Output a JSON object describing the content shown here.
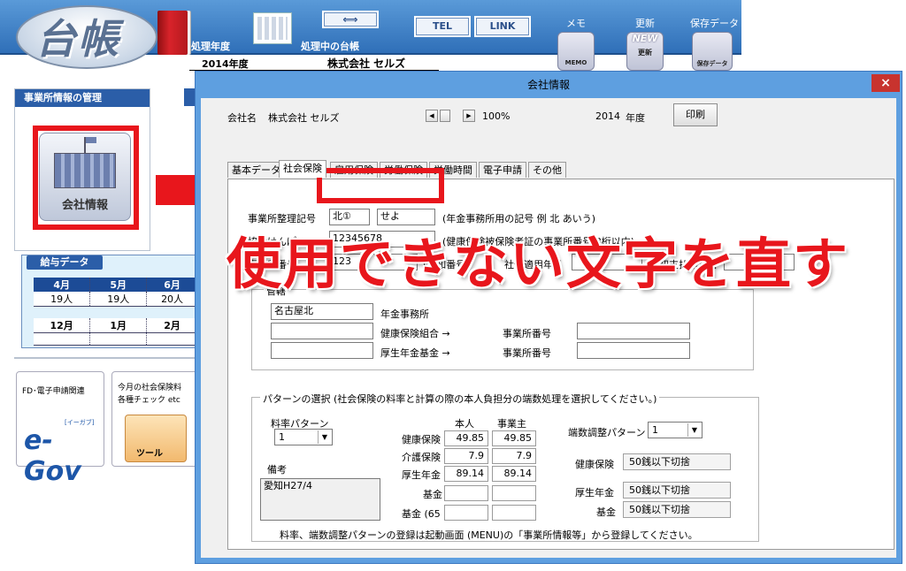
{
  "app": {
    "logo_text": "台帳",
    "top_labels": {
      "year_label": "処理年度",
      "ledger_label": "処理中の台帳",
      "memo": "メモ",
      "update": "更新",
      "save_data": "保存データ"
    },
    "nav": {
      "tel": "TEL",
      "link": "LINK"
    },
    "fiscal_year": "2014年度",
    "company": "株式会社 セルズ",
    "icon_labels": {
      "memo": "MEMO",
      "update_new": "NEW",
      "update_small": "更新",
      "save": "保存データ"
    },
    "left_panel": {
      "header": "事業所情報の管理",
      "company_info_button": "会社情報"
    },
    "salary": {
      "header": "給与データ",
      "row1_months": [
        "4月",
        "5月",
        "6月"
      ],
      "row1_counts": [
        "19人",
        "19人",
        "20人"
      ],
      "row2_months": [
        "12月",
        "1月",
        "2月"
      ]
    },
    "tiles": {
      "fd_label": "FD･電子申請関連",
      "egov": "e-Gov",
      "egov_small": "[イーガブ]",
      "monthly_line1": "今月の社会保険料",
      "monthly_line2": "各種チェック etc",
      "tool": "ツール"
    }
  },
  "dialog": {
    "title": "会社情報",
    "close": "×",
    "company_label": "会社名",
    "company_name": "株式会社 セルズ",
    "zoom": "100%",
    "year": "2014",
    "year_suffix": "年度",
    "print_button": "印刷",
    "tabs": [
      "基本データ",
      "社会保険",
      "雇用保険",
      "労働保険",
      "労働時間",
      "電子申請",
      "その他"
    ],
    "active_tab": 1,
    "office_code_label": "事業所整理記号",
    "office_code_1": "北①",
    "office_code_2": "せよ",
    "office_code_hint": "(年金事務所用の記号 例 北 あいう)",
    "kyokai_label": "協会けんぽNo",
    "kyokai_value": "12345678",
    "kyokai_hint": "(健康保険被保険者証の事業所番号 8桁以内)",
    "office_no_label": "事業所番号",
    "office_no_value": "123",
    "office_no_hint": "(告知番号)",
    "social_date_label": "社保適用年月",
    "first_pay_label": "最初支払年月日",
    "group_title": "管轄",
    "pension_office_value": "名古屋北",
    "pension_office_label": "年金事務所",
    "health_union_label": "健康保険組合 →",
    "welfare_fund_label": "厚生年金基金 →",
    "office_no_label2": "事業所番号",
    "office_no_label3": "事業所番号",
    "pattern_group_title": "パターンの選択 (社会保険の料率と計算の際の本人負担分の端数処理を選択してください。)",
    "rate_pattern_label": "料率パターン",
    "rate_pattern_value": "1",
    "note_label": "備考",
    "note_value": "愛知H27/4",
    "col_person": "本人",
    "col_employer": "事業主",
    "rates": [
      {
        "label": "健康保険",
        "person": "49.85",
        "employer": "49.85"
      },
      {
        "label": "介護保険",
        "person": "7.9",
        "employer": "7.9"
      },
      {
        "label": "厚生年金",
        "person": "89.14",
        "employer": "89.14"
      },
      {
        "label": "基金",
        "person": "",
        "employer": ""
      },
      {
        "label": "基金 (65",
        "person": "",
        "employer": ""
      }
    ],
    "rounding_label": "端数調整パターン",
    "rounding_value": "1",
    "rounding_rows": [
      {
        "label": "健康保険",
        "value": "50銭以下切捨"
      },
      {
        "label": "厚生年金",
        "value": "50銭以下切捨"
      },
      {
        "label": "基金",
        "value": "50銭以下切捨"
      }
    ],
    "footer_note": "料率、端数調整パターンの登録は起動画面 (MENU)の「事業所情報等」から登録してください。"
  },
  "overlay_text": "使用できない文字を直す",
  "colors": {
    "accent_red": "#e8161c",
    "header_blue": "#2b5ea8",
    "title_bar_blue": "#5e9fe0"
  }
}
